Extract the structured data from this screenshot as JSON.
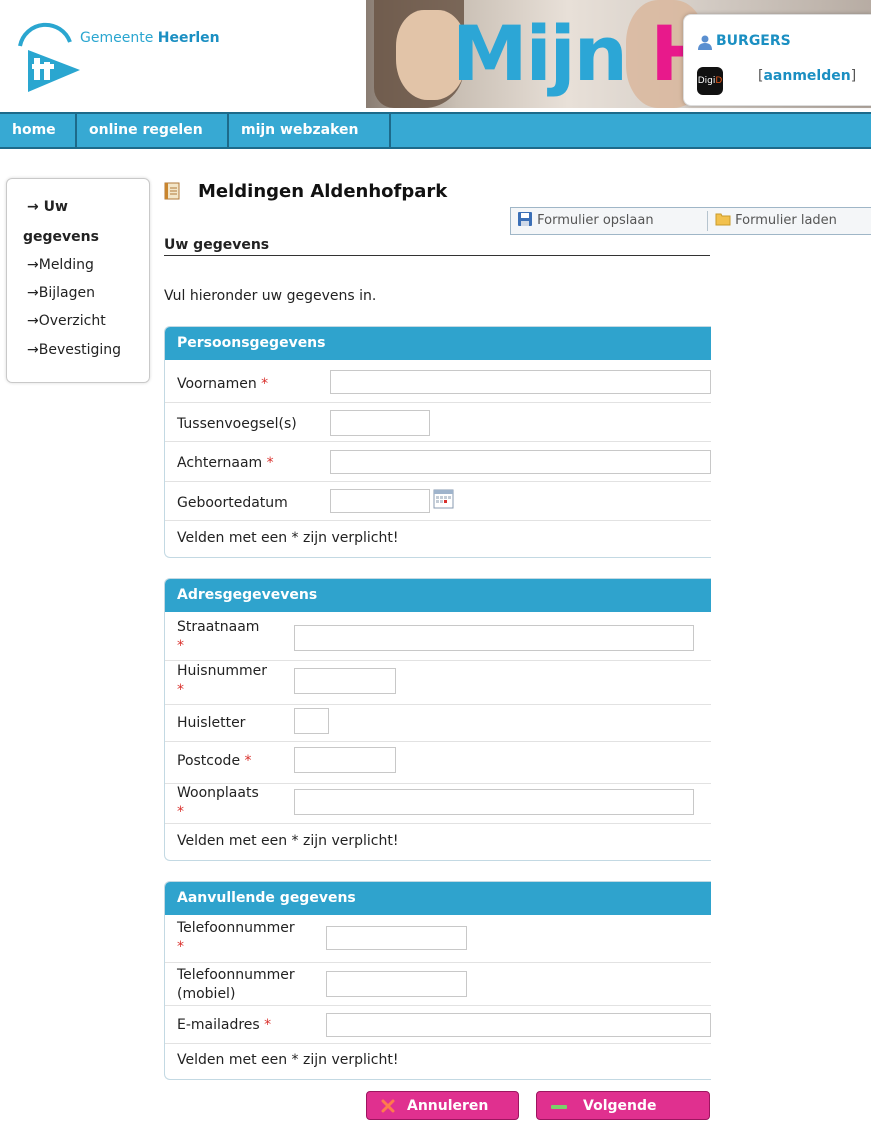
{
  "header": {
    "logo_prefix": "Gemeente ",
    "logo_name": "Heerlen",
    "banner_text_a": "Mijn ",
    "banner_text_b": "H",
    "user_type": "BURGERS",
    "digid_a": "Digi",
    "digid_b": "D",
    "login_open": "[",
    "login_label": "aanmelden",
    "login_close": "]"
  },
  "nav": {
    "items": [
      "home",
      "online regelen",
      "mijn webzaken"
    ]
  },
  "sidebar": {
    "items": [
      "Uw",
      "gegevens",
      "Melding",
      "Bijlagen",
      "Overzicht",
      "Bevestiging"
    ],
    "arrow": "→"
  },
  "page": {
    "title": "Meldingen Aldenhofpark",
    "save_label": "Formulier opslaan",
    "load_label": "Formulier laden",
    "section_heading": "Uw gegevens",
    "intro": "Vul hieronder uw gegevens in."
  },
  "persoonsgegevens": {
    "heading": "Persoonsgegevens",
    "voornamen": "Voornamen",
    "tussenvoegsel": "Tussenvoegsel(s)",
    "achternaam": "Achternaam",
    "geboortedatum": "Geboortedatum",
    "note": "Velden met een * zijn verplicht!"
  },
  "adresgegevens": {
    "heading": "Adresgegevevens",
    "straatnaam": "Straatnaam",
    "huisnummer": "Huisnummer",
    "huisletter": "Huisletter",
    "postcode": "Postcode",
    "woonplaats": "Woonplaats",
    "note": "Velden met een * zijn verplicht!"
  },
  "aanvullend": {
    "heading": "Aanvullende gegevens",
    "telefoon": "Telefoonnummer",
    "mobiel_a": "Telefoonnummer",
    "mobiel_b": "(mobiel)",
    "email": "E-mailadres",
    "note": "Velden met een * zijn verplicht!"
  },
  "required_mark": "*",
  "actions": {
    "cancel": "Annuleren",
    "next": "Volgende"
  },
  "colors": {
    "accent": "#2fa3cd",
    "brand_pink": "#e0308f",
    "required": "#d9302c"
  }
}
